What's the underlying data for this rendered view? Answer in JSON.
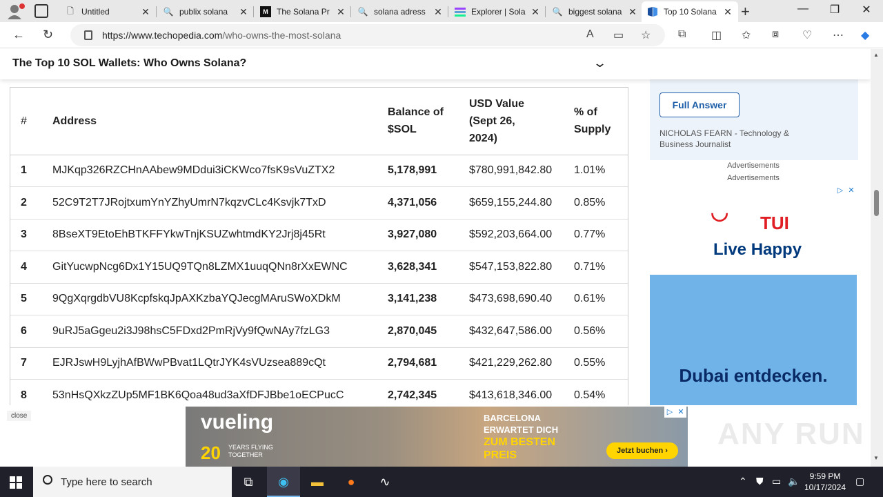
{
  "browser": {
    "tabs": [
      {
        "title": "Untitled",
        "icon": "page-icon"
      },
      {
        "title": "publix solana",
        "icon": "search-icon"
      },
      {
        "title": "The Solana Pr",
        "icon": "medium-icon"
      },
      {
        "title": "solana adress",
        "icon": "search-icon"
      },
      {
        "title": "Explorer | Sola",
        "icon": "solana-icon"
      },
      {
        "title": "biggest solana",
        "icon": "search-icon"
      },
      {
        "title": "Top 10 Solana",
        "icon": "techopedia-icon",
        "active": true
      }
    ],
    "url_host": "https://www.techopedia.com",
    "url_path": "/who-owns-the-most-solana"
  },
  "page": {
    "sticky_title": "The Top 10 SOL Wallets: Who Owns Solana?",
    "table": {
      "headers": {
        "num": "#",
        "address": "Address",
        "balance_1": "Balance of",
        "balance_2": "$SOL",
        "usd_1": "USD Value",
        "usd_2": "(Sept 26,",
        "usd_3": "2024)",
        "supply_1": "% of",
        "supply_2": "Supply"
      },
      "rows": [
        {
          "num": "1",
          "address": "MJKqp326RZCHnAAbew9MDdui3iCKWco7fsK9sVuZTX2",
          "balance": "5,178,991",
          "usd": "$780,991,842.80",
          "supply": "1.01%"
        },
        {
          "num": "2",
          "address": "52C9T2T7JRojtxumYnYZhyUmrN7kqzvCLc4Ksvjk7TxD",
          "balance": "4,371,056",
          "usd": "$659,155,244.80",
          "supply": "0.85%"
        },
        {
          "num": "3",
          "address": "8BseXT9EtoEhBTKFFYkwTnjKSUZwhtmdKY2Jrj8j45Rt",
          "balance": "3,927,080",
          "usd": "$592,203,664.00",
          "supply": "0.77%"
        },
        {
          "num": "4",
          "address": "GitYucwpNcg6Dx1Y15UQ9TQn8LZMX1uuqQNn8rXxEWNC",
          "balance": "3,628,341",
          "usd": "$547,153,822.80",
          "supply": "0.71%"
        },
        {
          "num": "5",
          "address": "9QgXqrgdbVU8KcpfskqJpAXKzbaYQJecgMAruSWoXDkM",
          "balance": "3,141,238",
          "usd": "$473,698,690.40",
          "supply": "0.61%"
        },
        {
          "num": "6",
          "address": "9uRJ5aGgeu2i3J98hsC5FDxd2PmRjVy9fQwNAy7fzLG3",
          "balance": "2,870,045",
          "usd": "$432,647,586.00",
          "supply": "0.56%"
        },
        {
          "num": "7",
          "address": "EJRJswH9LyjhAfBWwPBvat1LQtrJYK4sVUzsea889cQt",
          "balance": "2,794,681",
          "usd": "$421,229,262.80",
          "supply": "0.55%"
        },
        {
          "num": "8",
          "address": "53nHsQXkzZUp5MF1BK6Qoa48ud3aXfDFJBbe1oECPucC",
          "balance": "2,742,345",
          "usd": "$413,618,346.00",
          "supply": "0.54%"
        }
      ]
    },
    "sidebar": {
      "full_answer": "Full Answer",
      "author": "NICHOLAS FEARN",
      "author_role": "- Technology & Business Journalist",
      "ad_label_1": "Advertisements",
      "ad_label_2": "Advertisements",
      "tui_brand": "TUI",
      "tui_slogan": "Live Happy",
      "tui_headline": "Dubai entdecken."
    },
    "bottom_ad": {
      "close": "close",
      "brand": "vueling",
      "years": "20",
      "years_sub_1": "YEARS FLYING",
      "years_sub_2": "TOGETHER",
      "city_1": "BARCELONA",
      "city_2": "ERWARTET DICH",
      "preis_1": "ZUM BESTEN",
      "preis_2": "PREIS",
      "cta": "Jetzt buchen ›"
    },
    "watermark": "ANY RUN"
  },
  "taskbar": {
    "search_placeholder": "Type here to search",
    "time": "9:59 PM",
    "date": "10/17/2024"
  }
}
